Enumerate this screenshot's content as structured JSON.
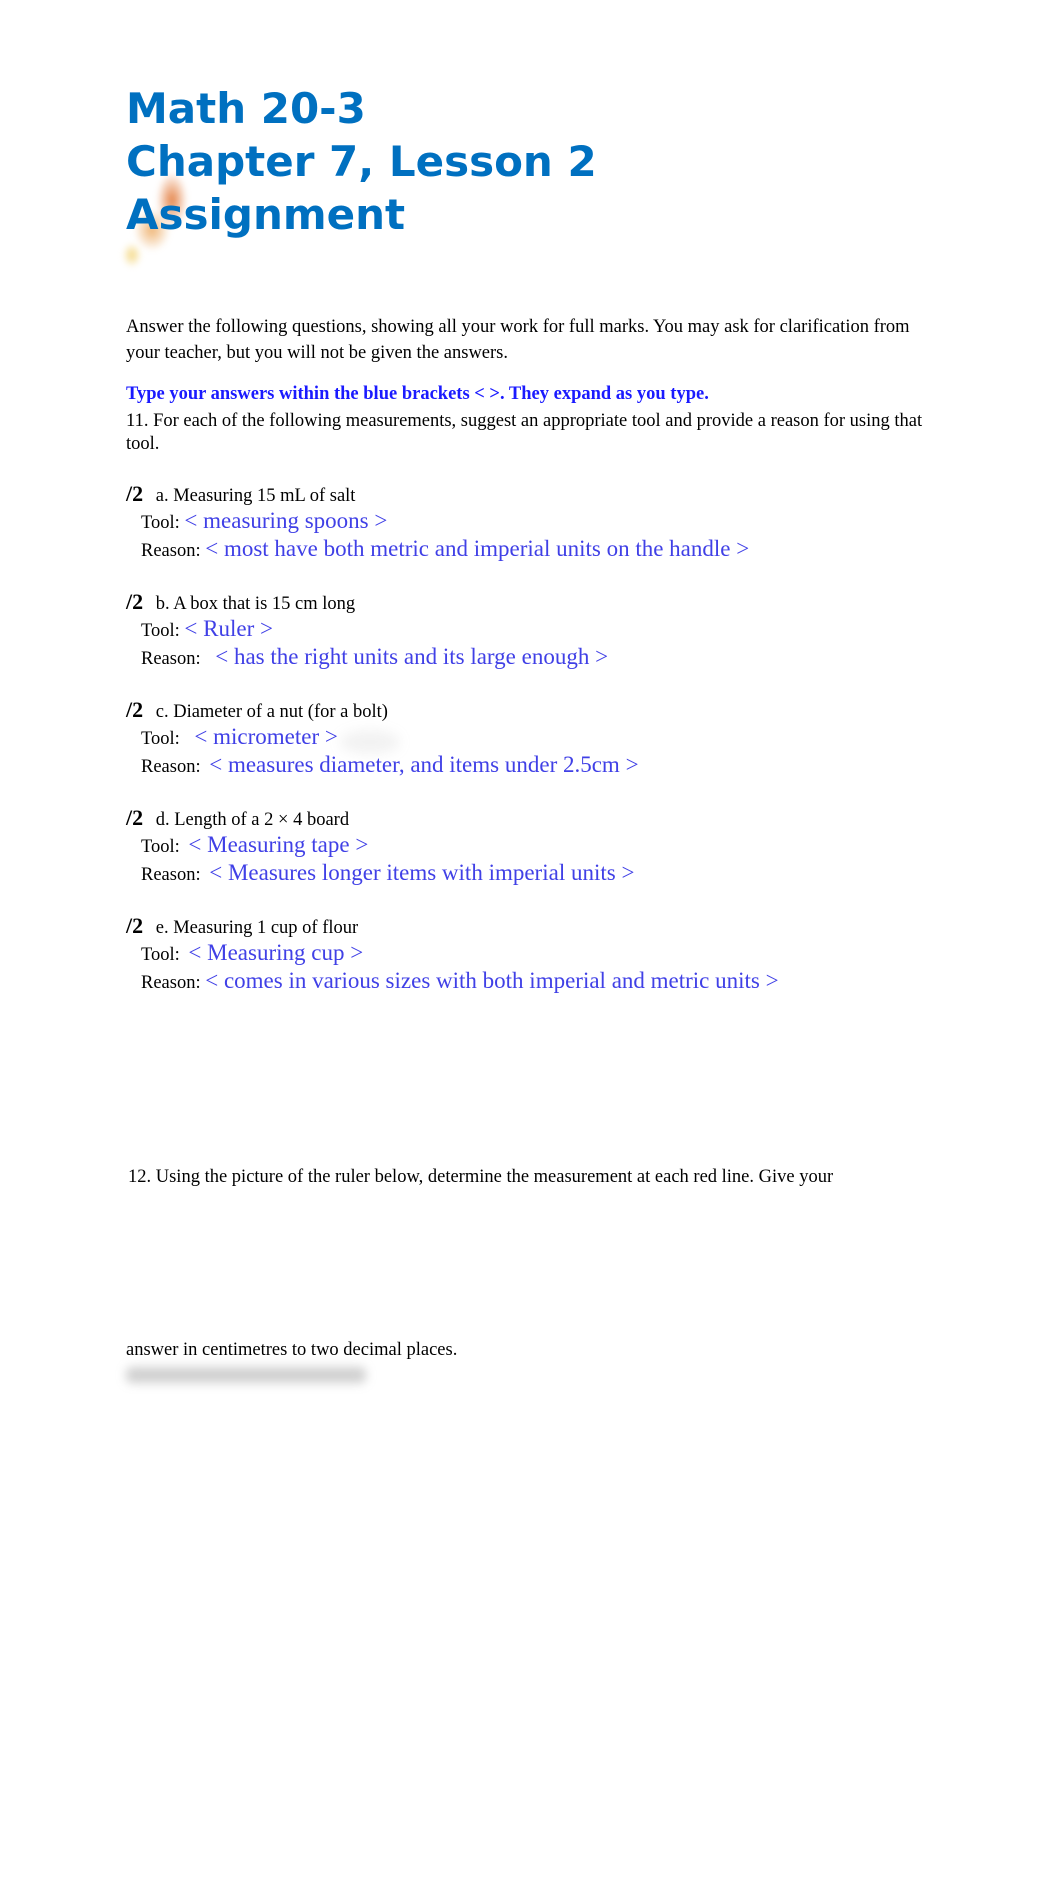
{
  "header": {
    "title_lines": [
      "Math 20-3",
      "Chapter 7, Lesson 2",
      "Assignment"
    ]
  },
  "intro": {
    "text": "Answer the following questions, showing all your work for full marks.  You may ask for clarification from your teacher, but you will not be given the answers.",
    "instruction": "Type your answers within the blue brackets < >. They expand as you type."
  },
  "question11": {
    "prompt": " 11. For each of the following measurements, suggest an appropriate tool and provide a reason for using that tool.",
    "tool_label": "Tool:",
    "reason_label": "Reason:",
    "items": [
      {
        "marks": "/2",
        "prompt": "a. Measuring 15 mL of salt",
        "tool": "< measuring spoons >",
        "reason": "< most have both metric and imperial units on the handle >"
      },
      {
        "marks": "/2",
        "prompt": "b. A box that is 15 cm long",
        "tool": "< Ruler >",
        "reason": "< has the right units and its large enough >"
      },
      {
        "marks": "/2",
        "prompt": "c. Diameter of a nut (for a bolt)",
        "tool": "< micrometer >",
        "reason": "< measures diameter, and items under 2.5cm >"
      },
      {
        "marks": "/2",
        "prompt": "d. Length of a 2 × 4 board",
        "tool": "< Measuring tape >",
        "reason": "< Measures longer items with imperial units >"
      },
      {
        "marks": "/2",
        "prompt": "e. Measuring 1 cup of flour",
        "tool": "< Measuring cup >",
        "reason": "< comes in various sizes with both imperial and metric units >"
      }
    ]
  },
  "question12": {
    "line1": "12. Using the picture of the ruler below, determine the measurement at each red line.  Give your",
    "line2": "answer in centimetres to two decimal places."
  }
}
